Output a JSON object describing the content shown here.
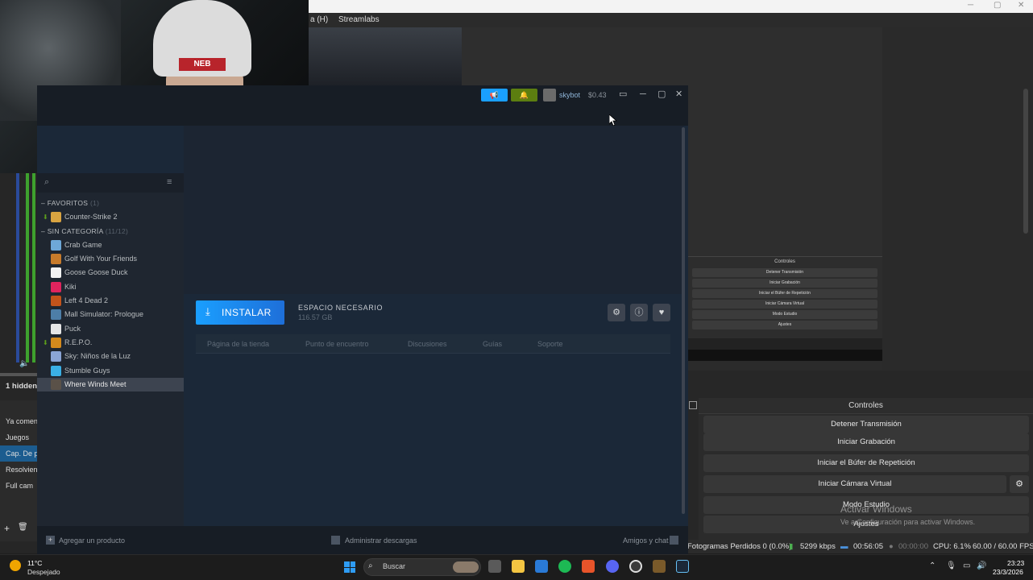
{
  "obs": {
    "menu": [
      "a (H)",
      "Streamlabs"
    ],
    "controls_title": "Controles",
    "buttons": {
      "stop_stream": "Detener Transmisión",
      "start_recording": "Iniciar Grabación",
      "start_replay": "Iniciar el Búfer de Repetición",
      "start_vcam": "Iniciar Cámara Virtual",
      "studio_mode": "Modo Estudio",
      "settings": "Ajustes"
    },
    "status": {
      "dropped_frames": "Fotogramas Perdidos 0 (0.0%)",
      "bitrate": "5299 kbps",
      "stream_time": "00:56:05",
      "rec_time": "00:00:00",
      "cpu": "CPU: 6.1%",
      "fps": "60.00 / 60.00 FPS"
    },
    "mini": {
      "controls_title": "Controles",
      "buttons": [
        "Detener Transmisión",
        "Iniciar Grabación",
        "Iniciar el Búfer de Repetición",
        "Iniciar Cámara Virtual",
        "Modo Estudio",
        "Ajustes"
      ]
    },
    "left_panel": {
      "hidden_label": "1 hidden",
      "scenes": [
        "Ya comen",
        "Juegos",
        "Cap. De pa",
        "Resolvien",
        "Full cam"
      ],
      "active_scene_index": 2
    },
    "activate_windows": "Activar Windows",
    "activate_windows_sub": "Ve a Configuración para activar Windows."
  },
  "steam": {
    "header": {
      "username": "skybot",
      "wallet": "$0.43"
    },
    "sidebar": {
      "favorites_label": "FAVORITOS",
      "favorites_count": "(1)",
      "uncategorized_label": "SIN CATEGORÍA",
      "uncategorized_count": "(11/12)",
      "favorites": [
        {
          "name": "Counter-Strike 2",
          "color": "#d9a441"
        }
      ],
      "games": [
        {
          "name": "Crab Game",
          "color": "#6ea8d8"
        },
        {
          "name": "Golf With Your Friends",
          "color": "#c77b2b"
        },
        {
          "name": "Goose Goose Duck",
          "color": "#f2f2f2"
        },
        {
          "name": "Kiki",
          "color": "#e0245e"
        },
        {
          "name": "Left 4 Dead 2",
          "color": "#c4541b"
        },
        {
          "name": "Mall Simulator: Prologue",
          "color": "#4d7ea8"
        },
        {
          "name": "Puck",
          "color": "#e6e6e6"
        },
        {
          "name": "R.E.P.O.",
          "color": "#d48a1d"
        },
        {
          "name": "Sky: Niños de la Luz",
          "color": "#8aa5d6"
        },
        {
          "name": "Stumble Guys",
          "color": "#3ab0e6"
        },
        {
          "name": "Where Winds Meet",
          "color": "#5a5148"
        }
      ],
      "add_product": "Agregar un producto"
    },
    "game": {
      "install_label": "INSTALAR",
      "space_label": "ESPACIO NECESARIO",
      "space_value": "116.57 GB",
      "tabs": [
        "Página de la tienda",
        "Punto de encuentro",
        "Discusiones",
        "Guías",
        "Soporte"
      ]
    },
    "footer": {
      "manage_downloads": "Administrar descargas",
      "friends_chat": "Amigos y chat"
    }
  },
  "taskbar": {
    "temperature": "11°C",
    "weather": "Despejado",
    "search_placeholder": "Buscar",
    "time": "23:23",
    "date": "23/3/2026"
  },
  "webcam": {
    "hat_logo": "NEB"
  }
}
